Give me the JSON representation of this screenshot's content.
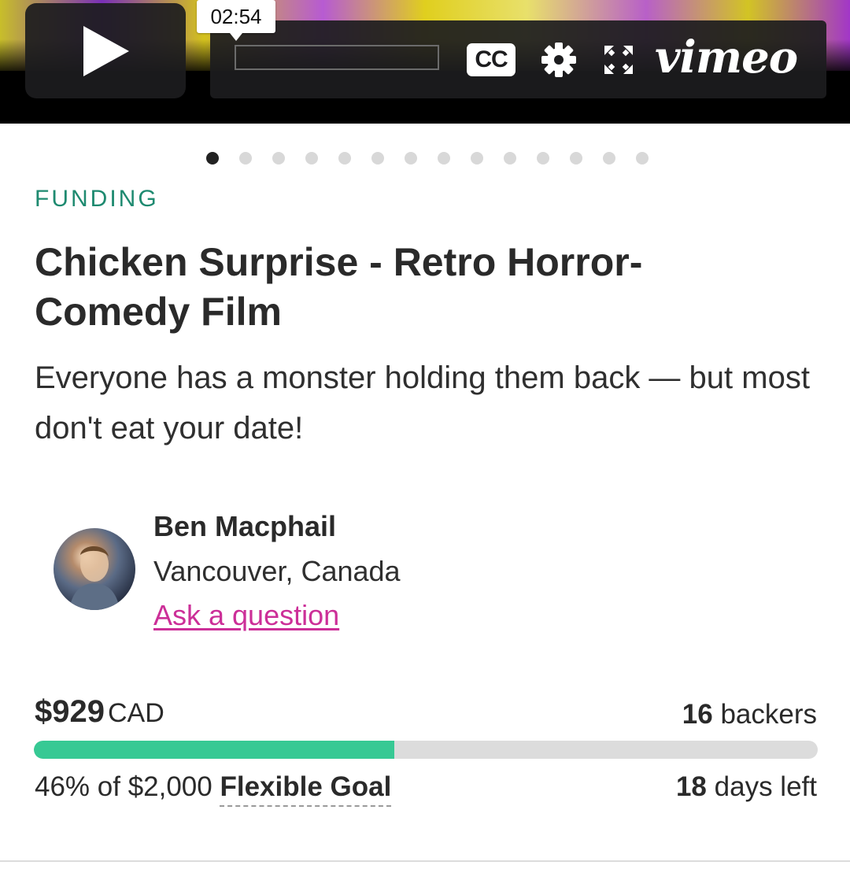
{
  "video": {
    "tooltip_time": "02:54",
    "cc_label": "CC",
    "brand": "vimeo",
    "icons": [
      "play-icon",
      "gear-icon",
      "fullscreen-icon"
    ]
  },
  "carousel": {
    "dot_count": 14,
    "active_index": 0
  },
  "project": {
    "category": "FUNDING",
    "title": "Chicken Surprise - Retro Horror-Comedy Film",
    "tagline": "Everyone has a monster holding them back — but most don't eat your date!"
  },
  "creator": {
    "name": "Ben Macphail",
    "location": "Vancouver, Canada",
    "ask_label": "Ask a question"
  },
  "funding": {
    "raised": "$929",
    "currency": "CAD",
    "backers_count": "16",
    "backers_label": "backers",
    "percent_text": "46% of $2,000",
    "goal_type": "Flexible Goal",
    "days_count": "18",
    "days_label": "days left",
    "progress_fraction": 0.46
  },
  "colors": {
    "category": "#1e8a70",
    "link": "#cc2f98",
    "progress": "#37c994"
  }
}
